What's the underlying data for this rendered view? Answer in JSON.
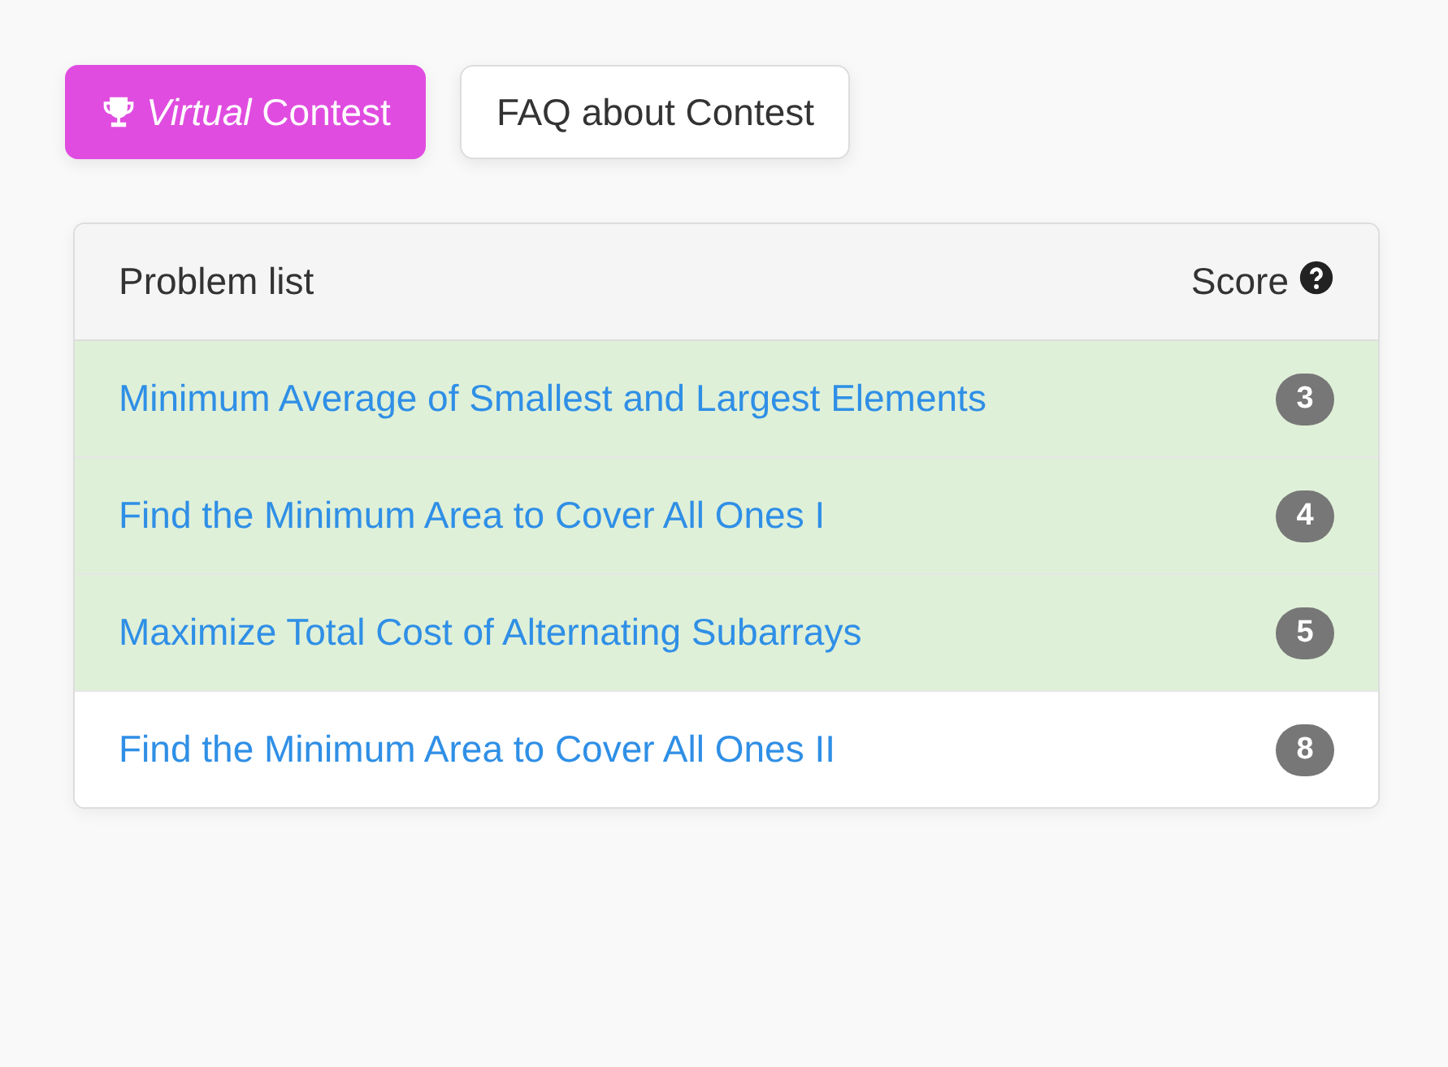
{
  "buttons": [
    {
      "kind": "primary",
      "label": "*Virtual* Contest"
    },
    {
      "kind": "default",
      "label": "FAQ about Contest"
    }
  ],
  "problem_list": {
    "title": "Problem list",
    "score_header": "Score",
    "rows": [
      {
        "title": "Minimum Average of Smallest and Largest Elements",
        "score": "3",
        "solved": true
      },
      {
        "title": "Find the Minimum Area to Cover All Ones I",
        "score": "4",
        "solved": true
      },
      {
        "title": "Maximize Total Cost of Alternating Subarrays",
        "score": "5",
        "solved": true
      },
      {
        "title": "Find the Minimum Area to Cover All Ones II",
        "score": "8",
        "solved": false
      }
    ]
  }
}
